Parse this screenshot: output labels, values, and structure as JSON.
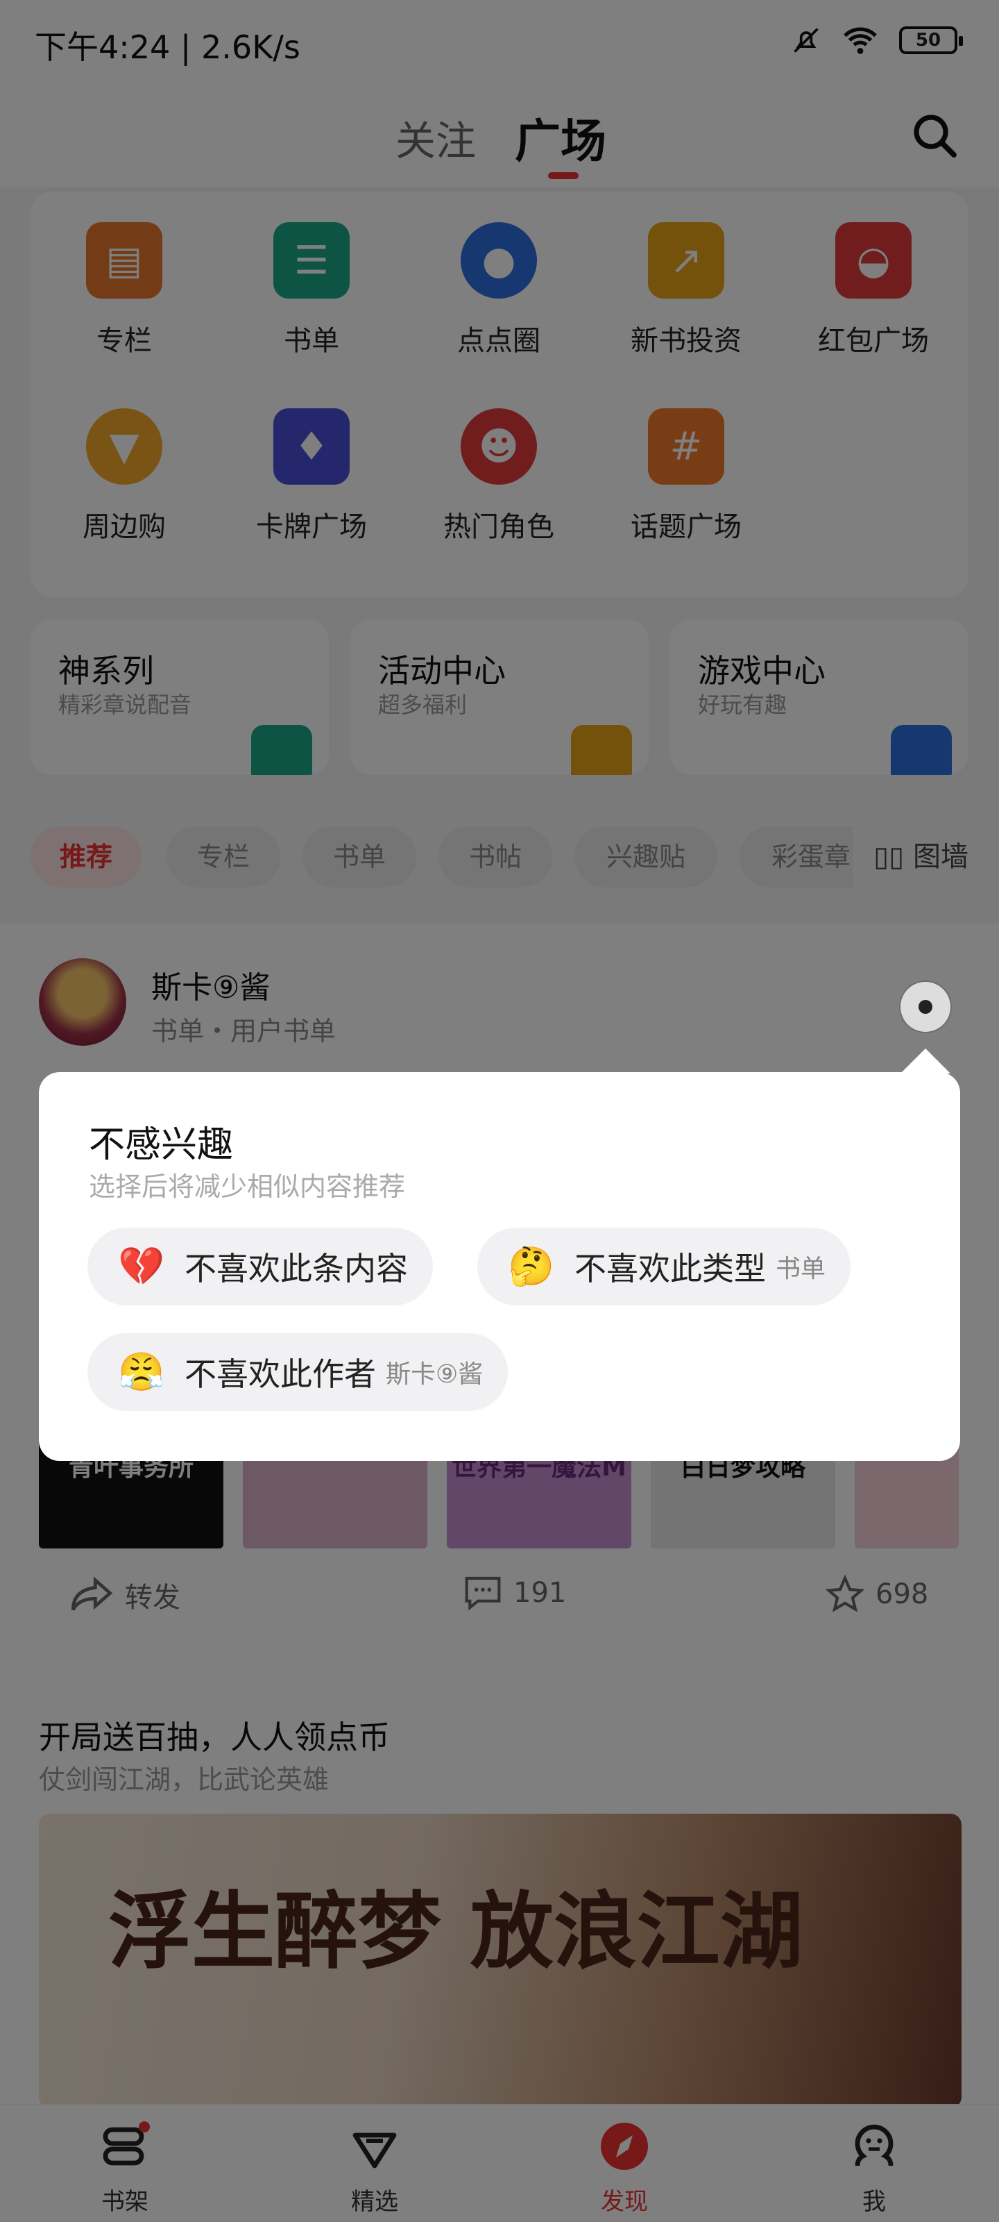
{
  "status_bar": {
    "time": "下午4:24 | 2.6K/s",
    "battery": "50"
  },
  "top_nav": {
    "tabs": [
      "关注",
      "广场"
    ],
    "active_tab": "广场"
  },
  "grid": {
    "items": [
      {
        "label": "专栏",
        "icon": "column-icon",
        "color": "#e8782c"
      },
      {
        "label": "书单",
        "icon": "booklist-icon",
        "color": "#1aa88b"
      },
      {
        "label": "点点圈",
        "icon": "circle-icon",
        "color": "#2f6fe0"
      },
      {
        "label": "新书投资",
        "icon": "investment-icon",
        "color": "#e9a418"
      },
      {
        "label": "红包广场",
        "icon": "red-packet-icon",
        "color": "#e23a3a"
      },
      {
        "label": "周边购",
        "icon": "fox-icon",
        "color": "#f2a82a"
      },
      {
        "label": "卡牌广场",
        "icon": "cards-icon",
        "color": "#4b4fd8"
      },
      {
        "label": "热门角色",
        "icon": "devil-icon",
        "color": "#e23a3a"
      },
      {
        "label": "话题广场",
        "icon": "hashtag-icon",
        "color": "#f07a2a"
      }
    ]
  },
  "features": [
    {
      "title": "神系列",
      "sub": "精彩章说配音",
      "color": "#1aa88b"
    },
    {
      "title": "活动中心",
      "sub": "超多福利",
      "color": "#e9a418"
    },
    {
      "title": "游戏中心",
      "sub": "好玩有趣",
      "color": "#2f6fe0"
    }
  ],
  "chips": [
    "推荐",
    "专栏",
    "书单",
    "书帖",
    "兴趣贴",
    "彩蛋章"
  ],
  "picwall_label": "图墙",
  "post": {
    "author": "斯卡⑨酱",
    "sub": "书单・用户书单",
    "covers": [
      "青叶事务所",
      "",
      "世界第一魔法M",
      "白日梦攻略",
      ""
    ],
    "share_label": "转发",
    "comment_count": "191",
    "like_count": "698"
  },
  "promo": {
    "title": "开局送百抽，人人领点币",
    "sub": "仗剑闯江湖，比武论英雄",
    "banner_text": "浮生醉梦 放浪江湖"
  },
  "popup": {
    "title": "不感兴趣",
    "subtitle": "选择后将减少相似内容推荐",
    "reasons": [
      {
        "text": "不喜欢此条内容",
        "tag": "",
        "emoji": "💔"
      },
      {
        "text": "不喜欢此类型",
        "tag": "书单",
        "emoji": "🤔"
      },
      {
        "text": "不喜欢此作者",
        "tag": "斯卡⑨酱",
        "emoji": "😤"
      }
    ]
  },
  "bottom_tabs": [
    {
      "label": "书架",
      "icon": "bookshelf-icon"
    },
    {
      "label": "精选",
      "icon": "diamond-icon"
    },
    {
      "label": "发现",
      "icon": "compass-icon"
    },
    {
      "label": "我",
      "icon": "profile-icon"
    }
  ],
  "active_bottom_tab": "发现",
  "colors": {
    "accent": "#e33333",
    "dim": "rgba(0,0,0,0.5)"
  }
}
